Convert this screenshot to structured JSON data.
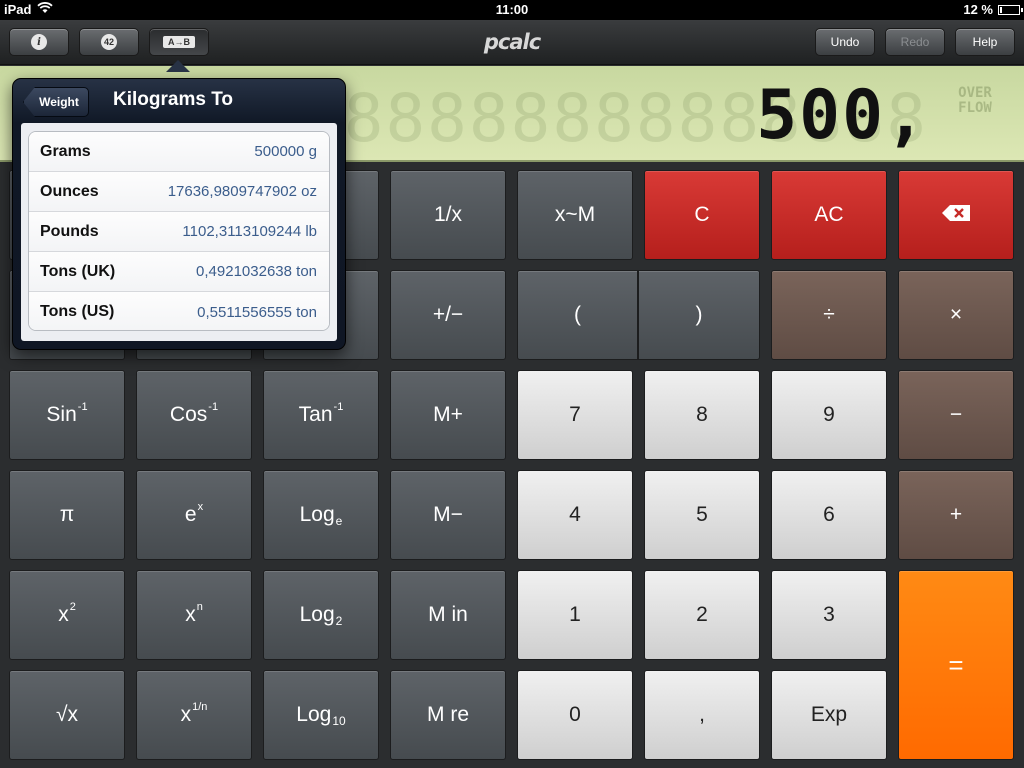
{
  "status_bar": {
    "device": "iPad",
    "time": "11:00",
    "battery_percent": "12 %",
    "battery_level": 0.12
  },
  "toolbar": {
    "info_icon": "i",
    "constants_icon": "42",
    "conversion_icon": "A→B",
    "logo": "pcalc",
    "undo": "Undo",
    "redo": "Redo",
    "help": "Help"
  },
  "display": {
    "value": "500,",
    "ghost": "888888888888888",
    "overflow_line1": "OVER",
    "overflow_line2": "FLOW"
  },
  "popover": {
    "back": "Weight",
    "title": "Kilograms To",
    "rows": [
      {
        "name": "Grams",
        "value": "500000 g"
      },
      {
        "name": "Ounces",
        "value": "17636,9809747902 oz"
      },
      {
        "name": "Pounds",
        "value": "1102,3113109244 lb"
      },
      {
        "name": "Tons (UK)",
        "value": "0,4921032638 ton"
      },
      {
        "name": "Tons (US)",
        "value": "0,5511556555 ton"
      }
    ]
  },
  "keys": {
    "reciprocal": "1/x",
    "swap_mem": "x~M",
    "clear": "C",
    "all_clear": "AC",
    "plus_minus": "+/−",
    "open_paren": "(",
    "close_paren": ")",
    "divide": "÷",
    "multiply": "×",
    "asin": "Sin",
    "asin_sup": "-1",
    "acos": "Cos",
    "acos_sup": "-1",
    "atan": "Tan",
    "atan_sup": "-1",
    "mem_plus": "M+",
    "d7": "7",
    "d8": "8",
    "d9": "9",
    "minus": "−",
    "pi": "π",
    "exp_base": "e",
    "exp_sup": "x",
    "ln": "Log",
    "ln_sub": "e",
    "mem_minus": "M−",
    "d4": "4",
    "d5": "5",
    "d6": "6",
    "plus": "+",
    "square": "x",
    "square_sup": "2",
    "power": "x",
    "power_sup": "n",
    "log2": "Log",
    "log2_sub": "2",
    "mem_in": "M in",
    "d1": "1",
    "d2": "2",
    "d3": "3",
    "equals": "=",
    "sqrt": "√x",
    "root": "x",
    "root_sup": "1/n",
    "log10": "Log",
    "log10_sub": "10",
    "mem_recall": "M re",
    "d0": "0",
    "decimal": ",",
    "exp": "Exp"
  },
  "colors": {
    "accent_orange": "#ff6a00",
    "clear_red": "#c62a27",
    "operator_brown": "#6b5750",
    "display_green": "#d4e2ac"
  }
}
